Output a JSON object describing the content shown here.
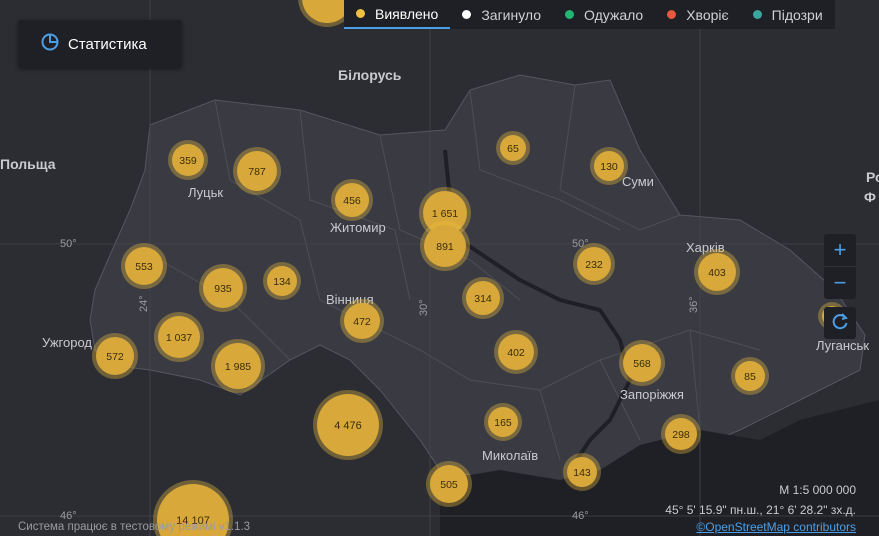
{
  "stat_button": {
    "label": "Статистика",
    "icon": "pie-chart-icon"
  },
  "tabs": [
    {
      "label": "Виявлено",
      "color": "#f0c040",
      "active": true
    },
    {
      "label": "Загинуло",
      "color": "#ffffff",
      "active": false
    },
    {
      "label": "Одужало",
      "color": "#22b573",
      "active": false
    },
    {
      "label": "Хворіє",
      "color": "#e8573f",
      "active": false
    },
    {
      "label": "Підозри",
      "color": "#3aa6a0",
      "active": false
    }
  ],
  "zoom": {
    "in": "+",
    "out": "−",
    "reset_icon": "refresh-icon"
  },
  "scale": "М 1:5 000 000",
  "coords": "45° 5' 15.9\" пн.ш., 21° 6' 28.2\" зх.д.",
  "attribution": "©OpenStreetMap contributors",
  "footer": "Система працює в тестовому режимі v1.1.3",
  "places": {
    "belarus": "Білорусь",
    "poland": "Польща",
    "russia_1": "Ро",
    "russia_2": "Ф",
    "lutsk": "Луцьк",
    "zhytomyr": "Житомир",
    "vinnytsia": "Вінниця",
    "uzhhorod": "Ужгород",
    "sumy": "Суми",
    "kharkiv": "Харків",
    "zaporizhzhia": "Запоріжжя",
    "mykolaiv": "Миколаїв",
    "luhansk": "Луганськ"
  },
  "grid_labels": {
    "lat50_left": "50°",
    "lat50_mid": "50°",
    "lon24": "24°",
    "lon30": "30°",
    "lon36": "36°",
    "lat46_left": "46°",
    "lat46_mid": "46°"
  },
  "clusters": [
    {
      "value": "359"
    },
    {
      "value": "787"
    },
    {
      "value": "456"
    },
    {
      "value": "1 651"
    },
    {
      "value": "891"
    },
    {
      "value": "65"
    },
    {
      "value": "130"
    },
    {
      "value": "553"
    },
    {
      "value": "935"
    },
    {
      "value": "134"
    },
    {
      "value": "232"
    },
    {
      "value": "403"
    },
    {
      "value": "314"
    },
    {
      "value": "1 037"
    },
    {
      "value": "472"
    },
    {
      "value": "572"
    },
    {
      "value": "1 985"
    },
    {
      "value": "402"
    },
    {
      "value": "568"
    },
    {
      "value": "85"
    },
    {
      "value": "4 476"
    },
    {
      "value": "165"
    },
    {
      "value": "298"
    },
    {
      "value": "143"
    },
    {
      "value": "505"
    },
    {
      "value": "14 107"
    },
    {
      "value": ""
    },
    {
      "value": ""
    }
  ]
}
